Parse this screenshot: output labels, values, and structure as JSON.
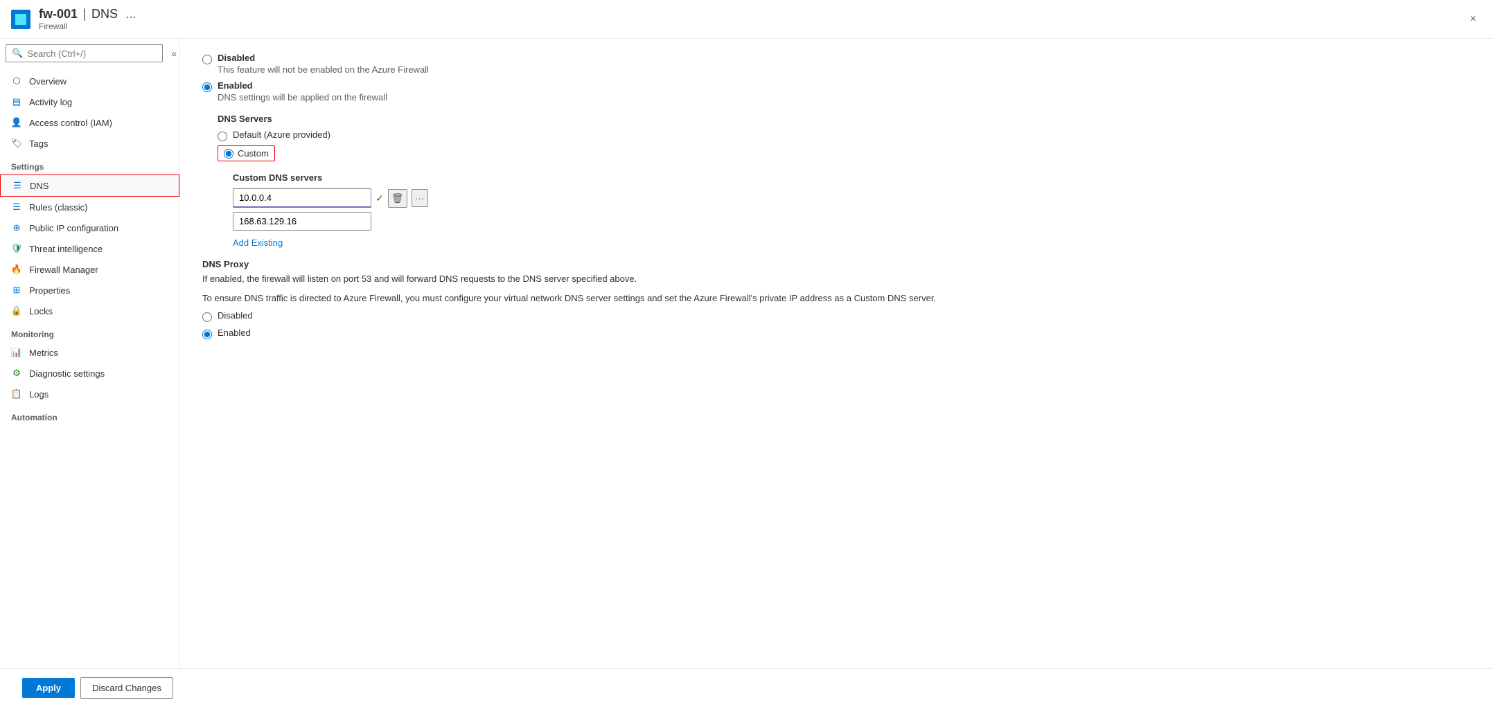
{
  "header": {
    "icon_label": "firewall-icon",
    "resource_name": "fw-001",
    "separator": "|",
    "page_title": "DNS",
    "resource_type": "Firewall",
    "more_options": "...",
    "close_label": "×"
  },
  "sidebar": {
    "search_placeholder": "Search (Ctrl+/)",
    "collapse_icon": "«",
    "nav_items": [
      {
        "id": "overview",
        "label": "Overview",
        "icon": "overview-icon"
      },
      {
        "id": "activity-log",
        "label": "Activity log",
        "icon": "activity-log-icon"
      },
      {
        "id": "access-control",
        "label": "Access control (IAM)",
        "icon": "access-control-icon"
      },
      {
        "id": "tags",
        "label": "Tags",
        "icon": "tags-icon"
      }
    ],
    "sections": [
      {
        "title": "Settings",
        "items": [
          {
            "id": "dns",
            "label": "DNS",
            "icon": "dns-icon",
            "active": true
          },
          {
            "id": "rules-classic",
            "label": "Rules (classic)",
            "icon": "rules-icon"
          },
          {
            "id": "public-ip",
            "label": "Public IP configuration",
            "icon": "public-ip-icon"
          },
          {
            "id": "threat-intel",
            "label": "Threat intelligence",
            "icon": "threat-intel-icon"
          },
          {
            "id": "firewall-manager",
            "label": "Firewall Manager",
            "icon": "firewall-manager-icon"
          },
          {
            "id": "properties",
            "label": "Properties",
            "icon": "properties-icon"
          },
          {
            "id": "locks",
            "label": "Locks",
            "icon": "locks-icon"
          }
        ]
      },
      {
        "title": "Monitoring",
        "items": [
          {
            "id": "metrics",
            "label": "Metrics",
            "icon": "metrics-icon"
          },
          {
            "id": "diagnostic-settings",
            "label": "Diagnostic settings",
            "icon": "diagnostic-icon"
          },
          {
            "id": "logs",
            "label": "Logs",
            "icon": "logs-icon"
          }
        ]
      },
      {
        "title": "Automation",
        "items": []
      }
    ]
  },
  "content": {
    "top_radio_group": {
      "disabled_label": "Disabled",
      "disabled_desc": "This feature will not be enabled on the Azure Firewall",
      "enabled_label": "Enabled",
      "enabled_desc": "DNS settings will be applied on the firewall",
      "enabled_selected": true
    },
    "dns_servers": {
      "label": "DNS Servers",
      "default_label": "Default (Azure provided)",
      "custom_label": "Custom",
      "custom_selected": true
    },
    "custom_dns": {
      "label": "Custom DNS servers",
      "servers": [
        {
          "value": "10.0.0.4",
          "active": true
        },
        {
          "value": "168.63.129.16",
          "active": false
        }
      ],
      "add_existing_label": "Add Existing"
    },
    "dns_proxy": {
      "title": "DNS Proxy",
      "desc1": "If enabled, the firewall will listen on port 53 and will forward DNS requests to the DNS server specified above.",
      "desc2": "To ensure DNS traffic is directed to Azure Firewall, you must configure your virtual network DNS server settings and set the Azure Firewall's private IP address as a Custom DNS server.",
      "disabled_label": "Disabled",
      "enabled_label": "Enabled",
      "enabled_selected": true
    }
  },
  "footer": {
    "apply_label": "Apply",
    "discard_label": "Discard Changes"
  }
}
